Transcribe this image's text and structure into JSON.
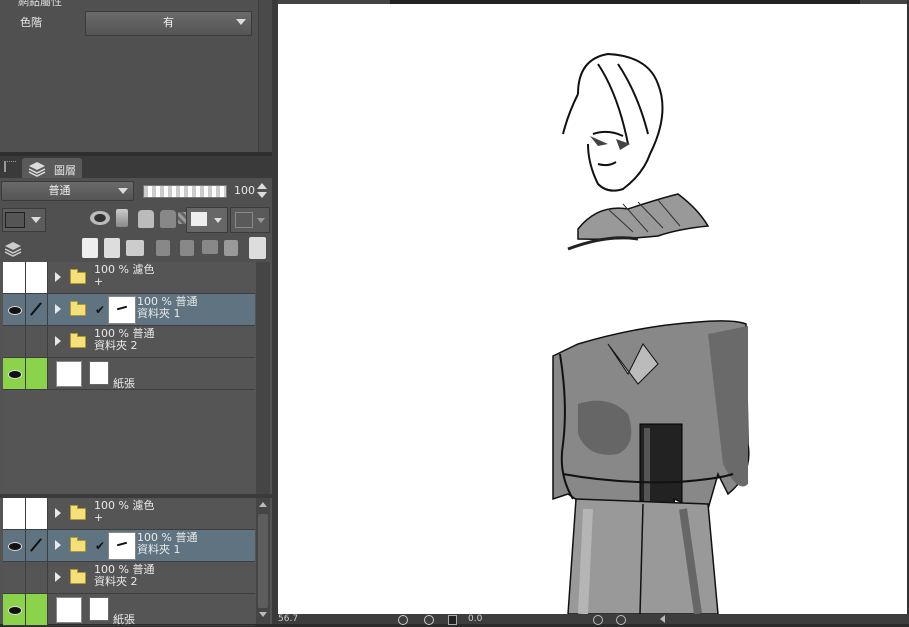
{
  "properties": {
    "title": "網點屬性",
    "tone_label": "色階",
    "tone_value": "有"
  },
  "layer_panel": {
    "tab_label": "圖層",
    "blend_mode": "普通",
    "opacity": "100"
  },
  "layers_top": [
    {
      "line1": "100 % 濾色",
      "line2": "+",
      "type": "folder",
      "eye": false,
      "selected": false
    },
    {
      "line1": "100 % 普通",
      "line2": "資料夾 1",
      "type": "folder-thumb",
      "eye": true,
      "selected": true
    },
    {
      "line1": "100 % 普通",
      "line2": "資料夾 2",
      "type": "folder",
      "eye": false,
      "selected": false
    },
    {
      "line1": "紙張",
      "line2": "",
      "type": "paper",
      "eye": true,
      "selected": false
    }
  ],
  "layers_bottom": [
    {
      "line1": "100 % 濾色",
      "line2": "+"
    },
    {
      "line1": "100 % 普通",
      "line2": "資料夾 1"
    },
    {
      "line1": "100 % 普通",
      "line2": "資料夾 2"
    },
    {
      "line1": "紙張",
      "line2": ""
    }
  ],
  "status": {
    "zoom": "56.7",
    "rotation": "0.0"
  },
  "icons": [
    "layer-panel-icon",
    "eye-icon",
    "pen-icon",
    "folder-icon",
    "lock-icon",
    "trash-icon",
    "new-layer-icon"
  ]
}
